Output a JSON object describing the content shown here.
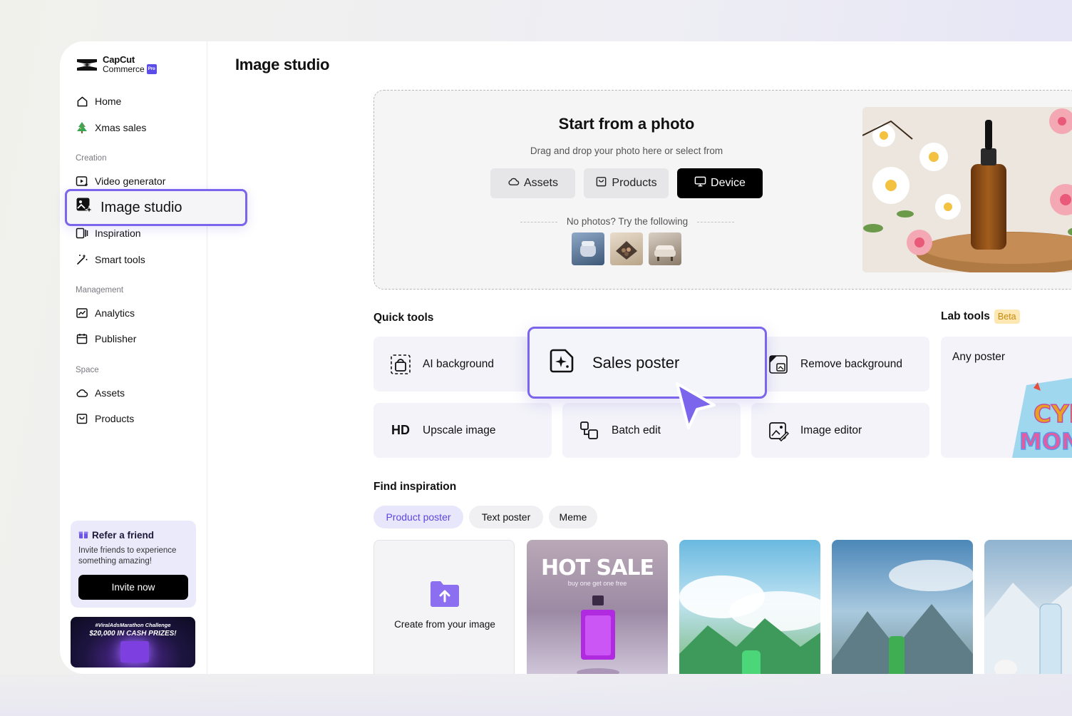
{
  "app": {
    "logo_line1": "CapCut",
    "logo_line2": "Commerce",
    "logo_badge": "Pro"
  },
  "sidebar": {
    "items_top": [
      {
        "label": "Home",
        "icon": "home-icon"
      },
      {
        "label": "Xmas sales",
        "icon": "tree-icon"
      }
    ],
    "section_creation": "Creation",
    "items_creation": [
      {
        "label": "Video generator",
        "icon": "video-generator-icon"
      },
      {
        "label": "Image studio",
        "icon": "image-studio-icon"
      },
      {
        "label": "Inspiration",
        "icon": "inspiration-icon"
      },
      {
        "label": "Smart tools",
        "icon": "magic-wand-icon"
      }
    ],
    "section_management": "Management",
    "items_management": [
      {
        "label": "Analytics",
        "icon": "analytics-icon"
      },
      {
        "label": "Publisher",
        "icon": "calendar-icon"
      }
    ],
    "section_space": "Space",
    "items_space": [
      {
        "label": "Assets",
        "icon": "cloud-icon"
      },
      {
        "label": "Products",
        "icon": "bag-icon"
      }
    ],
    "refer": {
      "title": "Refer a friend",
      "desc": "Invite friends to experience something amazing!",
      "button": "Invite now"
    },
    "promo": {
      "line1": "#ViralAdsMarathon Challenge",
      "line2": "$20,000 IN CASH PRIZES!"
    }
  },
  "main": {
    "title": "Image studio",
    "upload": {
      "heading": "Start from a photo",
      "sub": "Drag and drop your photo here or select from",
      "buttons": [
        "Assets",
        "Products",
        "Device"
      ],
      "try_text": "No photos? Try the following"
    },
    "quick_tools_title": "Quick tools",
    "lab_tools_title": "Lab tools",
    "lab_badge": "Beta",
    "tools": [
      {
        "label": "AI background",
        "icon": "ai-background-icon"
      },
      {
        "label": "Sales poster",
        "icon": "sales-poster-icon"
      },
      {
        "label": "Remove background",
        "icon": "remove-background-icon"
      },
      {
        "label": "Upscale image",
        "icon": "hd-icon",
        "icon_text": "HD"
      },
      {
        "label": "Batch edit",
        "icon": "batch-edit-icon"
      },
      {
        "label": "Image editor",
        "icon": "image-editor-icon"
      }
    ],
    "lab_tool": "Any poster",
    "find_inspiration_title": "Find inspiration",
    "chips": [
      "Product poster",
      "Text poster",
      "Meme"
    ],
    "create_card": "Create from your image",
    "poster": {
      "title": "HOT SALE",
      "sub": "buy one get one free"
    }
  },
  "colors": {
    "accent": "#7b65ec",
    "chip_active": "#5b47e0",
    "beta_bg": "#fde7b3",
    "beta_text": "#c58a0d"
  }
}
